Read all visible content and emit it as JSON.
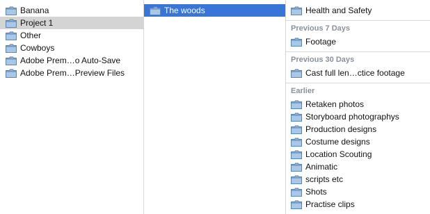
{
  "column1": {
    "items": [
      {
        "label": "Banana",
        "selected": false
      },
      {
        "label": "Project 1",
        "selected": true
      },
      {
        "label": "Other",
        "selected": false
      },
      {
        "label": "Cowboys",
        "selected": false
      },
      {
        "label": "Adobe Prem…o Auto-Save",
        "selected": false
      },
      {
        "label": "Adobe Prem…Preview Files",
        "selected": false
      }
    ]
  },
  "column2": {
    "items": [
      {
        "label": "The woods",
        "selected": true
      }
    ]
  },
  "column3": {
    "top_items": [
      {
        "label": "Health and Safety"
      }
    ],
    "sections": [
      {
        "title": "Previous 7 Days",
        "items": [
          {
            "label": "Footage"
          }
        ]
      },
      {
        "title": "Previous 30 Days",
        "items": [
          {
            "label": "Cast full len…ctice footage"
          }
        ]
      },
      {
        "title": "Earlier",
        "items": [
          {
            "label": "Retaken photos"
          },
          {
            "label": "Storyboard photographys"
          },
          {
            "label": "Production designs"
          },
          {
            "label": "Costume designs"
          },
          {
            "label": "Location Scouting"
          },
          {
            "label": "Animatic"
          },
          {
            "label": "scripts etc"
          },
          {
            "label": "Shots"
          },
          {
            "label": "Practise clips"
          }
        ]
      }
    ]
  },
  "icons": {
    "folder": "folder-icon"
  },
  "colors": {
    "selection_blue": "#3875d7",
    "selection_gray": "#d4d4d4",
    "section_header": "#8a919a"
  }
}
